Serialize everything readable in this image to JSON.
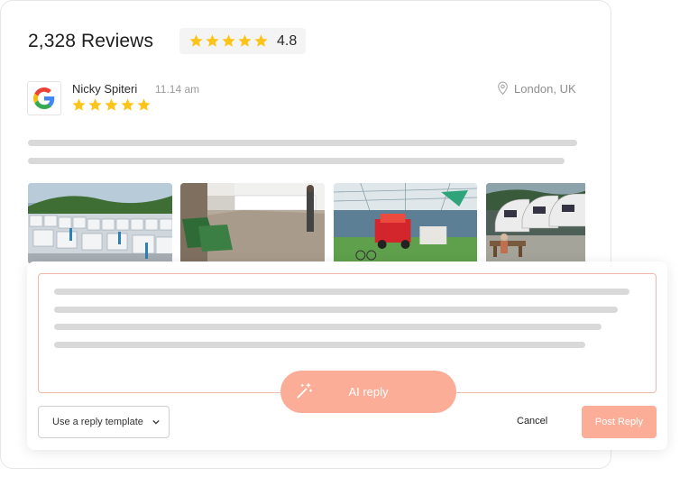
{
  "header": {
    "reviews_count_label": "2,328 Reviews",
    "rating_value": "4.8",
    "rating_stars": 5
  },
  "review": {
    "source_icon": "google-icon",
    "reviewer_name": "Nicky Spiteri",
    "time": "11.14 am",
    "stars": 5,
    "location": "London, UK",
    "photos": [
      {
        "icon": "caravan-park-photo"
      },
      {
        "icon": "showroom-interior-photo"
      },
      {
        "icon": "indoor-exhibition-photo"
      },
      {
        "icon": "caravan-display-photo"
      }
    ]
  },
  "reply": {
    "ai_reply_label": "AI reply",
    "template_select_label": "Use a reply template",
    "cancel_label": "Cancel",
    "post_reply_label": "Post Reply"
  },
  "colors": {
    "accent": "#fcad98",
    "textarea_border": "#f0b8a8",
    "star": "#fcc419",
    "skeleton": "#d9d9d9"
  }
}
